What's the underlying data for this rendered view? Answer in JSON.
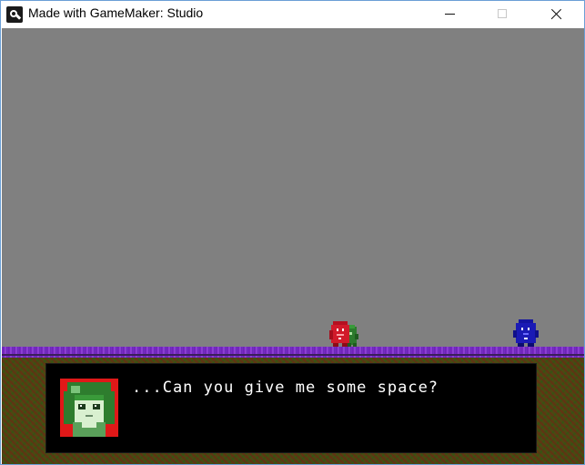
{
  "window": {
    "title": "Made with GameMaker: Studio",
    "icon": "gamemaker-icon",
    "controls": [
      "minimize-icon",
      "maximize-icon",
      "close-icon"
    ]
  },
  "game": {
    "background_color": "#808080",
    "dialog": {
      "text": "...Can you give me some space?",
      "portrait": "green-haired-character-portrait"
    },
    "characters": [
      {
        "name": "red-character",
        "color": "#d11a2a"
      },
      {
        "name": "green-character",
        "color": "#3a9a3a"
      },
      {
        "name": "blue-character",
        "color": "#1a1ab5"
      }
    ]
  }
}
